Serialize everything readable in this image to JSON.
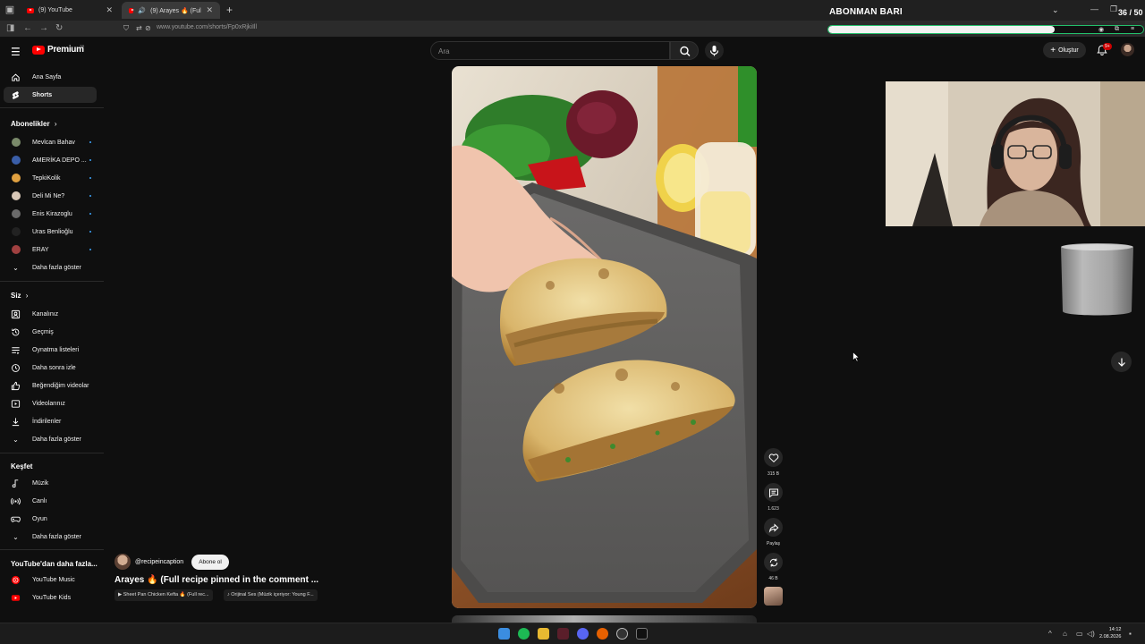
{
  "browser": {
    "tabs": [
      {
        "label": "(9) YouTube",
        "active": false
      },
      {
        "label": "(9) Arayes 🔥 (Full recipe p",
        "active": true
      }
    ],
    "url": "www.youtube.com/shorts/Fp0xRjkiIll"
  },
  "overlay": {
    "title": "ABONMAN BARI",
    "count": "36 / 50",
    "progress": 0.72,
    "bar_color": "#23c06b"
  },
  "masthead": {
    "brand": "Premium",
    "brand_mark": "TR",
    "search_placeholder": "Ara",
    "create_label": "Oluştur",
    "notif_badge": "9+"
  },
  "sidebar": {
    "main": [
      {
        "label": "Ana Sayfa",
        "icon": "home-icon",
        "active": false
      },
      {
        "label": "Shorts",
        "icon": "shorts-icon",
        "active": true
      }
    ],
    "subscriptions_header": "Abonelikler",
    "subscriptions": [
      {
        "label": "Mevlcan Bahav",
        "color": "#7a8a6a"
      },
      {
        "label": "AMERİKA DEPO ...",
        "color": "#3a5ea8"
      },
      {
        "label": "TepkiKolik",
        "color": "#e0a040"
      },
      {
        "label": "Deli Mi Ne?",
        "color": "#d8c8b8"
      },
      {
        "label": "Enis Kirazoglu",
        "color": "#6a6a6a"
      },
      {
        "label": "Uras Benlioğlu",
        "color": "#222222"
      },
      {
        "label": "ERAY",
        "color": "#a04040"
      }
    ],
    "subs_more": "Daha fazla göster",
    "you_header": "Siz",
    "you": [
      {
        "label": "Kanalınız",
        "icon": "channel-icon"
      },
      {
        "label": "Geçmiş",
        "icon": "history-icon"
      },
      {
        "label": "Oynatma listeleri",
        "icon": "playlist-icon"
      },
      {
        "label": "Daha sonra izle",
        "icon": "clock-icon"
      },
      {
        "label": "Beğendiğim videolar",
        "icon": "thumbs-up-icon"
      },
      {
        "label": "Videolarınız",
        "icon": "video-icon"
      },
      {
        "label": "İndirilenler",
        "icon": "download-icon"
      }
    ],
    "you_more": "Daha fazla göster",
    "explore_header": "Keşfet",
    "explore": [
      {
        "label": "Müzik",
        "icon": "music-icon"
      },
      {
        "label": "Canlı",
        "icon": "live-icon"
      },
      {
        "label": "Oyun",
        "icon": "gaming-icon"
      }
    ],
    "explore_more": "Daha fazla göster",
    "more_yt_header": "YouTube'dan daha fazla...",
    "more_yt": [
      {
        "label": "YouTube Music"
      },
      {
        "label": "YouTube Kids"
      }
    ]
  },
  "short": {
    "channel": "@recipeincaption",
    "subscribe": "Abone ol",
    "title": "Arayes 🔥 (Full recipe pinned in the comment ...",
    "chip_1": "▶ Sheet Pan Chicken Kefta 🔥 (Full rec...",
    "chip_2": "♪ Orijinal Ses (Müzik içeriyor: Young F...",
    "likes": "315 B",
    "comments": "1.623",
    "share": "Paylaş",
    "remix": "46 B"
  },
  "taskbar": {
    "time": "14:12",
    "date": "2.08.2026"
  }
}
